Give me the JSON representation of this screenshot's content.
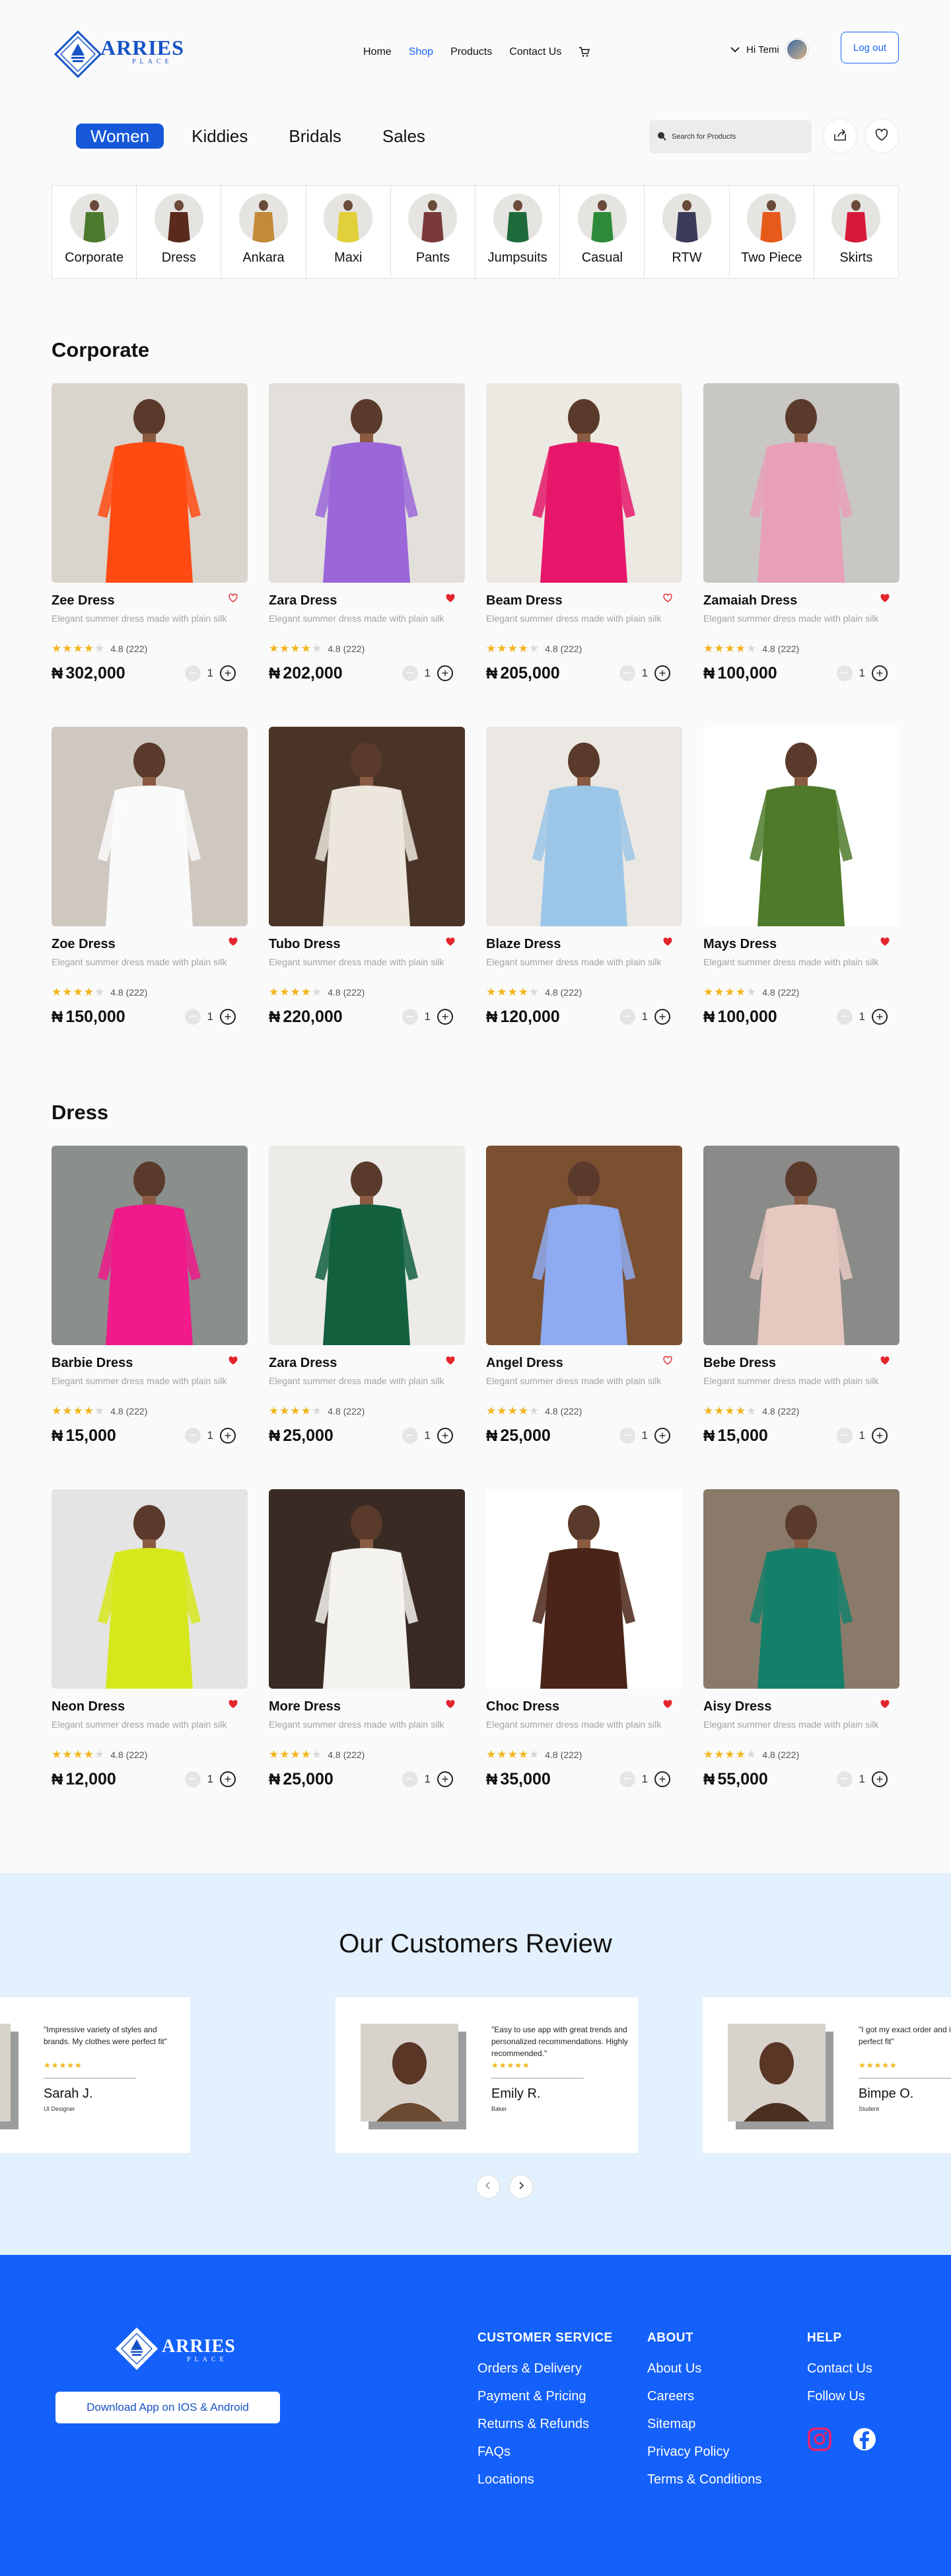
{
  "brand": {
    "name": "ARRIES",
    "sub": "PLACE"
  },
  "nav": [
    "Home",
    "Shop",
    "Products",
    "Contact Us"
  ],
  "nav_active": "Shop",
  "user": {
    "greeting": "Hi Temi",
    "logout": "Log out"
  },
  "category_tabs": [
    "Women",
    "Kiddies",
    "Bridals",
    "Sales"
  ],
  "category_active": "Women",
  "search": {
    "placeholder": "Search for Products"
  },
  "subcategories": [
    {
      "label": "Corporate",
      "color": "#4c7a2c"
    },
    {
      "label": "Dress",
      "color": "#5a2a1c"
    },
    {
      "label": "Ankara",
      "color": "#c28a3a"
    },
    {
      "label": "Maxi",
      "color": "#e2d03a"
    },
    {
      "label": "Pants",
      "color": "#7a3a3a"
    },
    {
      "label": "Jumpsuits",
      "color": "#1e6a3a"
    },
    {
      "label": "Casual",
      "color": "#2e8a3a"
    },
    {
      "label": "RTW",
      "color": "#3a3a5a"
    },
    {
      "label": "Two Piece",
      "color": "#e65a1a"
    },
    {
      "label": "Skirts",
      "color": "#d8183a"
    }
  ],
  "sections": [
    {
      "title": "Corporate",
      "products": [
        {
          "name": "Zee Dress",
          "price": "302,000",
          "heart": "outline",
          "bg": "#d9d4cc",
          "accent": "#ff4a12"
        },
        {
          "name": "Zara Dress",
          "price": "202,000",
          "heart": "filled",
          "bg": "#e3e0dc",
          "accent": "#9a66d8"
        },
        {
          "name": "Beam Dress",
          "price": "205,000",
          "heart": "outline",
          "bg": "#ece8e2",
          "accent": "#e6176a"
        },
        {
          "name": "Zamaiah Dress",
          "price": "100,000",
          "heart": "filled",
          "bg": "#c9c7c4",
          "accent": "#e8a0b8"
        },
        {
          "name": "Zoe Dress",
          "price": "150,000",
          "heart": "filled",
          "bg": "#cfc8c0",
          "accent": "#fafafa"
        },
        {
          "name": "Tubo Dress",
          "price": "220,000",
          "heart": "filled",
          "bg": "#4a3428",
          "accent": "#ece6dc"
        },
        {
          "name": "Blaze Dress",
          "price": "120,000",
          "heart": "filled",
          "bg": "#ebe7e2",
          "accent": "#9cc6e8"
        },
        {
          "name": "Mays Dress",
          "price": "100,000",
          "heart": "filled",
          "bg": "#ffffff",
          "accent": "#4e7a2a"
        }
      ]
    },
    {
      "title": "Dress",
      "products": [
        {
          "name": "Barbie Dress",
          "price": "15,000",
          "heart": "filled",
          "bg": "#8a8f8c",
          "accent": "#f01a8a"
        },
        {
          "name": "Zara Dress",
          "price": "25,000",
          "heart": "filled",
          "bg": "#ecebe8",
          "accent": "#12603e"
        },
        {
          "name": "Angel Dress",
          "price": "25,000",
          "heart": "outline",
          "bg": "#7a5030",
          "accent": "#8eaaf0"
        },
        {
          "name": "Bebe Dress",
          "price": "15,000",
          "heart": "filled",
          "bg": "#8a8a88",
          "accent": "#e6c8c0"
        },
        {
          "name": "Neon Dress",
          "price": "12,000",
          "heart": "filled",
          "bg": "#e4e4e4",
          "accent": "#d6e81c"
        },
        {
          "name": "More Dress",
          "price": "25,000",
          "heart": "filled",
          "bg": "#3a2a24",
          "accent": "#f4f2ee"
        },
        {
          "name": "Choc Dress",
          "price": "35,000",
          "heart": "filled",
          "bg": "#ffffff",
          "accent": "#4a2418"
        },
        {
          "name": "Aisy Dress",
          "price": "55,000",
          "heart": "filled",
          "bg": "#8a7a6a",
          "accent": "#14806a"
        }
      ]
    }
  ],
  "product_common": {
    "description": "Elegant summer dress made with plain silk",
    "rating": "4.8 (222)",
    "qty": "1",
    "currency": "₦"
  },
  "reviews": {
    "title": "Our Customers Review",
    "items": [
      {
        "quote": "\"Impressive variety of styles and brands. My clothes were perfect fit\"",
        "name": "Sarah J.",
        "role": "UI Designer",
        "photo": "#b8242e"
      },
      {
        "quote": "\"Easy to use app with great trends and personalized recommendations. Highly recommended.\"",
        "name": "Emily R.",
        "role": "Baker",
        "photo": "#6a4a30"
      },
      {
        "quote": "\"I got my exact order and it was a perfect fit\"",
        "name": "Bimpe O.",
        "role": "Student",
        "photo": "#4a3020"
      }
    ],
    "stars": "★★★★★"
  },
  "footer": {
    "download": "Download App on IOS & Android",
    "columns": [
      {
        "title": "CUSTOMER SERVICE",
        "links": [
          "Orders & Delivery",
          "Payment & Pricing",
          "Returns & Refunds",
          "FAQs",
          "Locations"
        ]
      },
      {
        "title": "ABOUT",
        "links": [
          "About Us",
          "Careers",
          "Sitemap",
          "Privacy Policy",
          "Terms & Conditions"
        ]
      },
      {
        "title": "HELP",
        "links": [
          "Contact Us",
          "Follow Us"
        ]
      }
    ],
    "social": [
      "instagram-icon",
      "facebook-icon"
    ]
  },
  "colors": {
    "primary": "#1460fa",
    "active_tab": "#1658d8",
    "heart": "#e5252d",
    "star": "#f3b51c",
    "review_bg": "#e3f0fd"
  }
}
